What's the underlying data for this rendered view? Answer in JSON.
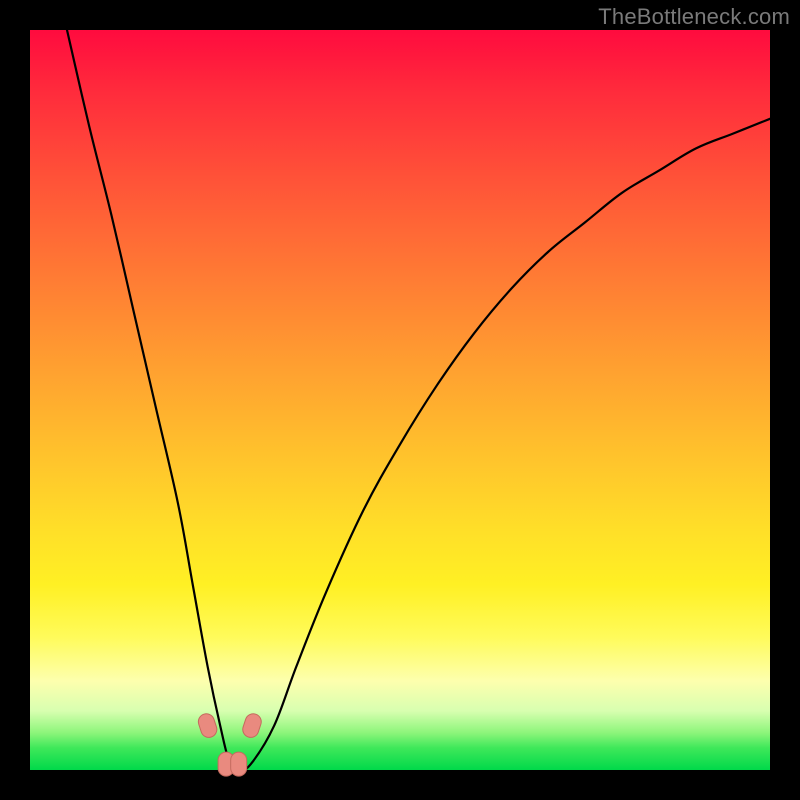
{
  "watermark": {
    "text": "TheBottleneck.com"
  },
  "colors": {
    "frame": "#000000",
    "curve_stroke": "#000000",
    "marker_fill": "#e98a7f",
    "marker_stroke": "#c46a5e",
    "gradient_stops": [
      "#ff0b3e",
      "#ff2a3c",
      "#ff5238",
      "#ff7a34",
      "#ffa130",
      "#ffc42c",
      "#ffe028",
      "#fff024",
      "#fffb5a",
      "#fdffae",
      "#d8ffb0",
      "#8cf57a",
      "#3fe85a",
      "#00d94a"
    ]
  },
  "chart_data": {
    "type": "line",
    "title": "",
    "xlabel": "",
    "ylabel": "",
    "xlim": [
      0,
      100
    ],
    "ylim": [
      0,
      100
    ],
    "grid": false,
    "legend": false,
    "note": "Values are estimated from pixel positions; y=0 is bottom (green), y=100 is top (red). x is horizontal position as percent of plot width.",
    "series": [
      {
        "name": "bottleneck-curve",
        "x": [
          5,
          8,
          11,
          14,
          17,
          20,
          22,
          24,
          25.7,
          27,
          28.4,
          30,
          33,
          36,
          40,
          45,
          50,
          55,
          60,
          65,
          70,
          75,
          80,
          85,
          90,
          95,
          100
        ],
        "y": [
          100,
          87,
          75,
          62,
          49,
          36,
          25,
          14,
          6,
          1,
          0,
          1,
          6,
          14,
          24,
          35,
          44,
          52,
          59,
          65,
          70,
          74,
          78,
          81,
          84,
          86,
          88
        ]
      }
    ],
    "markers": [
      {
        "x": 24.0,
        "y": 6.0
      },
      {
        "x": 26.5,
        "y": 0.8
      },
      {
        "x": 28.2,
        "y": 0.8
      },
      {
        "x": 30.0,
        "y": 6.0
      }
    ]
  }
}
